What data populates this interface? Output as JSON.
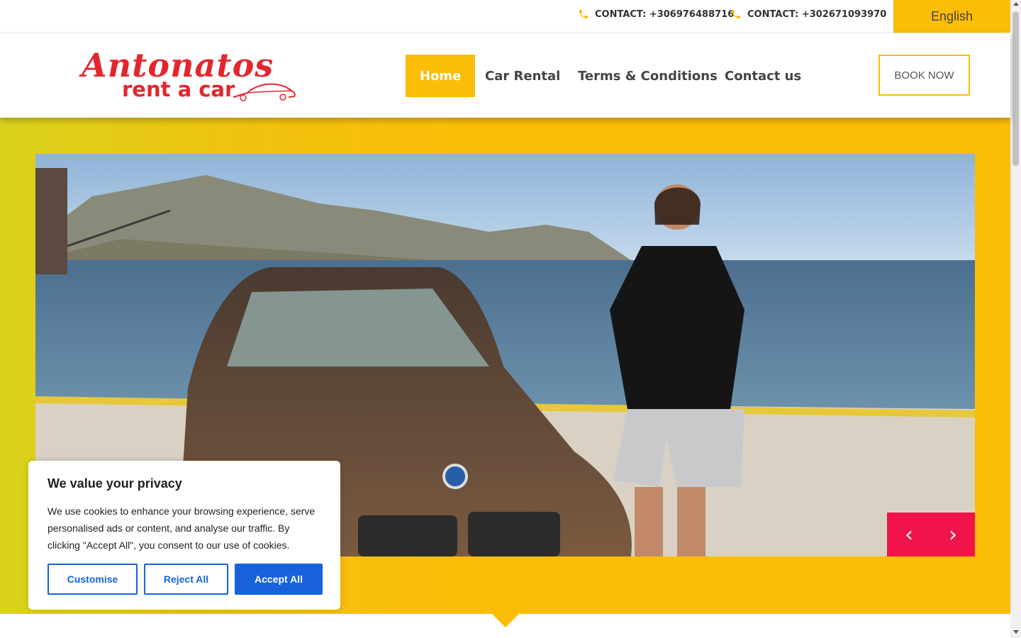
{
  "topbar": {
    "contacts": [
      {
        "label": "CONTACT: +306976488716",
        "icon": "phone-icon"
      },
      {
        "label": "CONTACT: +302671093970",
        "icon": "phone-icon"
      }
    ],
    "language": "English"
  },
  "logo": {
    "title": "Antonatos",
    "subtitle": "rent a car"
  },
  "nav": {
    "items": [
      {
        "label": "Home",
        "active": true
      },
      {
        "label": "Car Rental"
      },
      {
        "label": "Terms & Conditions"
      },
      {
        "label": "Contact us"
      }
    ],
    "book_label": "BOOK NOW"
  },
  "slider": {
    "prev_icon": "chevron-left-icon",
    "next_icon": "chevron-right-icon",
    "prev_glyph": "‹",
    "next_glyph": "›"
  },
  "cookie": {
    "title": "We value your privacy",
    "text": "We use cookies to enhance your browsing experience, serve personalised ads or content, and analyse our traffic. By clicking \"Accept All\", you consent to our use of cookies.",
    "buttons": {
      "customise": "Customise",
      "reject": "Reject All",
      "accept": "Accept All"
    }
  },
  "colors": {
    "accent": "#fbbd08",
    "brand_red": "#e3262d",
    "slider_nav": "#f0144a",
    "cookie_primary": "#1863dc"
  }
}
